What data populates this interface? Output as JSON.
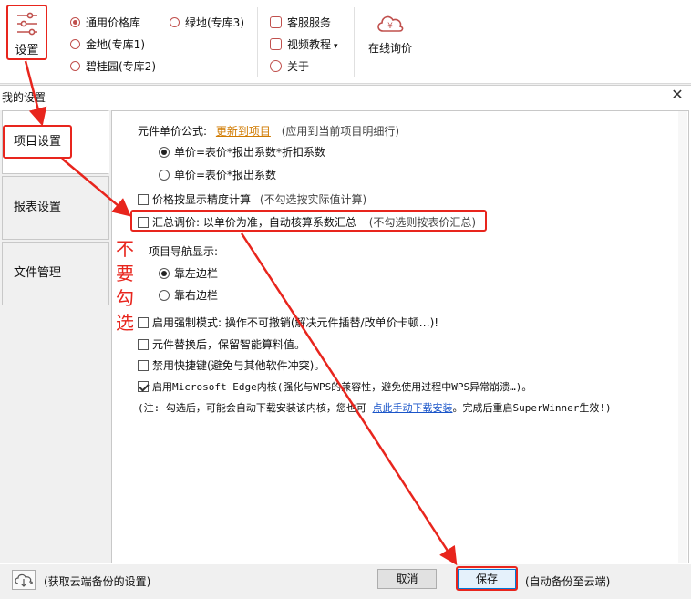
{
  "ribbon": {
    "settings_label": "设置",
    "libraries": [
      "通用价格库",
      "金地(专库1)",
      "碧桂园(专库2)",
      "绿地(专库3)"
    ],
    "menu": [
      "客服服务",
      "视频教程",
      "关于"
    ],
    "inquiry_label": "在线询价",
    "accent_color": "#c0504d"
  },
  "dialog": {
    "title": "我的设置",
    "close_glyph": "✕",
    "nav": [
      "项目设置",
      "报表设置",
      "文件管理"
    ],
    "unit_price": {
      "label": "元件单价公式:",
      "link": "更新到项目",
      "hint": "(应用到当前项目明细行)",
      "options": [
        "单价=表价*报出系数*折扣系数",
        "单价=表价*报出系数"
      ],
      "selected": 0
    },
    "precision": {
      "label": "价格按显示精度计算",
      "hint": "(不勾选按实际值计算)",
      "checked": false
    },
    "summary": {
      "label": "汇总调价: 以单价为准，自动核算系数汇总",
      "hint": "(不勾选则按表价汇总)",
      "checked": false
    },
    "nav_display": {
      "label": "项目导航显示:",
      "options": [
        "靠左边栏",
        "靠右边栏"
      ],
      "selected": 0
    },
    "force_mode": {
      "label": "启用强制模式: 操作不可撤销(解决元件插替/改单价卡顿…)!",
      "checked": false
    },
    "keep_formula": {
      "label": "元件替换后，保留智能算料值。",
      "checked": false
    },
    "disable_hotkeys": {
      "label": "禁用快捷键(避免与其他软件冲突)。",
      "checked": false
    },
    "edge_core": {
      "label": "启用Microsoft Edge内核(强化与WPS的兼容性，避免使用过程中WPS异常崩溃…)。",
      "checked": true
    },
    "note": {
      "prefix": "(注: 勾选后，可能会自动下载安装该内核，您也可",
      "link": "点此手动下载安装",
      "suffix": "。完成后重启SuperWinner生效!)"
    },
    "footer": {
      "cloud_hint": "(获取云端备份的设置)",
      "cancel_label": "取消",
      "save_label": "保存",
      "save_hint": "(自动备份至云端)"
    }
  },
  "annotation": {
    "chars": [
      "不",
      "要",
      "勾",
      "选"
    ],
    "color": "#e8251d"
  }
}
